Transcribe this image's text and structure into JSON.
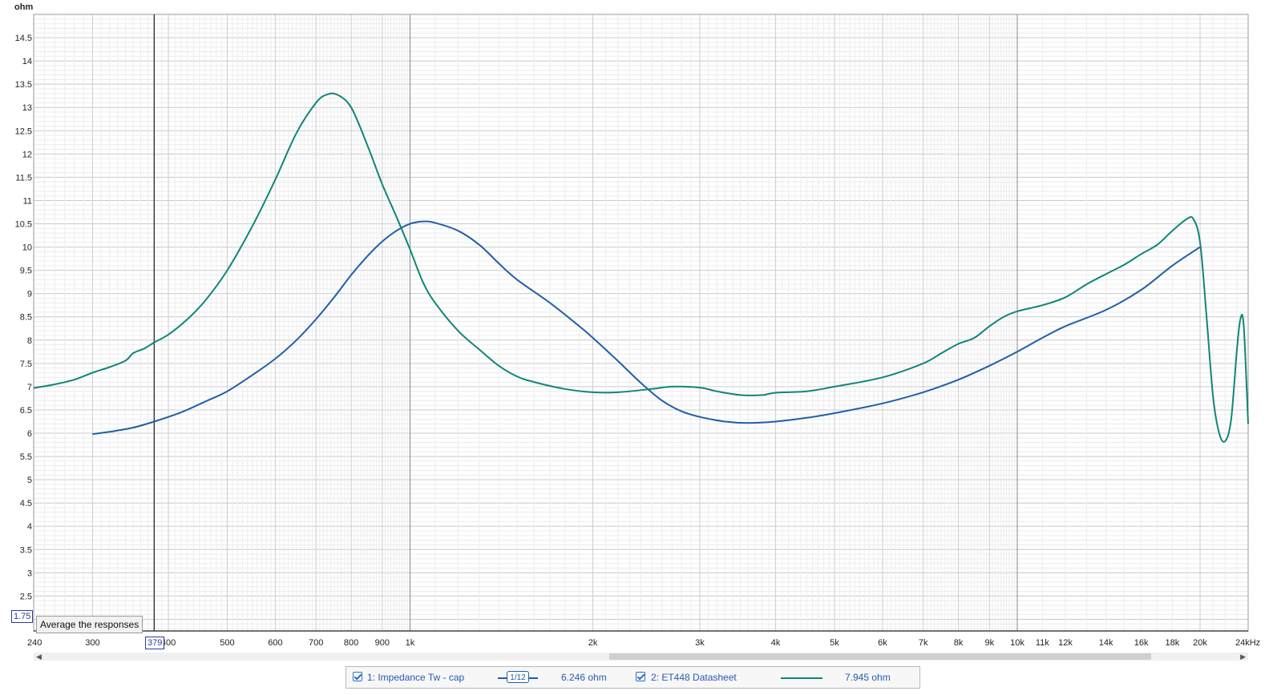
{
  "chart_data": {
    "type": "line",
    "ylabel": "ohm",
    "xunit": "Hz",
    "xscale": "log",
    "xlim": [
      240,
      24000
    ],
    "ylim": [
      1.75,
      15
    ],
    "grid": true,
    "y_ticks": [
      2,
      2.5,
      3,
      3.5,
      4,
      4.5,
      5,
      5.5,
      6,
      6.5,
      7,
      7.5,
      8,
      8.5,
      9,
      9.5,
      10,
      10.5,
      11,
      11.5,
      12,
      12.5,
      13,
      13.5,
      14,
      14.5
    ],
    "y_tick_labels": [
      "2",
      "2.5",
      "3",
      "3.5",
      "4",
      "4.5",
      "5",
      "5.5",
      "6",
      "6.5",
      "7",
      "7.5",
      "8",
      "8.5",
      "9",
      "9.5",
      "10",
      "10.5",
      "11",
      "11.5",
      "12",
      "12.5",
      "13",
      "13.5",
      "14",
      "14.5"
    ],
    "x_ticks": [
      {
        "value": 240,
        "label": "240"
      },
      {
        "value": 300,
        "label": "300"
      },
      {
        "value": 400,
        "label": "400"
      },
      {
        "value": 500,
        "label": "500"
      },
      {
        "value": 600,
        "label": "600"
      },
      {
        "value": 700,
        "label": "700"
      },
      {
        "value": 800,
        "label": "800"
      },
      {
        "value": 900,
        "label": "900"
      },
      {
        "value": 1000,
        "label": "1k"
      },
      {
        "value": 2000,
        "label": "2k"
      },
      {
        "value": 3000,
        "label": "3k"
      },
      {
        "value": 4000,
        "label": "4k"
      },
      {
        "value": 5000,
        "label": "5k"
      },
      {
        "value": 6000,
        "label": "6k"
      },
      {
        "value": 7000,
        "label": "7k"
      },
      {
        "value": 8000,
        "label": "8k"
      },
      {
        "value": 9000,
        "label": "9k"
      },
      {
        "value": 10000,
        "label": "10k"
      },
      {
        "value": 11000,
        "label": "11k"
      },
      {
        "value": 12000,
        "label": "12k"
      },
      {
        "value": 14000,
        "label": "14k"
      },
      {
        "value": 16000,
        "label": "16k"
      },
      {
        "value": 18000,
        "label": "18k"
      },
      {
        "value": 20000,
        "label": "20k"
      },
      {
        "value": 24000,
        "label": "24kHz"
      }
    ],
    "y_axis_lower_value": "1.75",
    "cursor": {
      "x": 379,
      "x_label": "379",
      "y": 1.75
    },
    "series": [
      {
        "name": "1: Impedance Tw - cap",
        "color": "#1f5fa8",
        "points": [
          [
            300,
            5.98
          ],
          [
            320,
            6.03
          ],
          [
            350,
            6.12
          ],
          [
            379,
            6.25
          ],
          [
            420,
            6.45
          ],
          [
            460,
            6.68
          ],
          [
            500,
            6.9
          ],
          [
            550,
            7.25
          ],
          [
            600,
            7.6
          ],
          [
            650,
            8.0
          ],
          [
            700,
            8.45
          ],
          [
            750,
            8.92
          ],
          [
            800,
            9.4
          ],
          [
            850,
            9.8
          ],
          [
            900,
            10.12
          ],
          [
            950,
            10.35
          ],
          [
            1000,
            10.5
          ],
          [
            1050,
            10.55
          ],
          [
            1100,
            10.52
          ],
          [
            1200,
            10.35
          ],
          [
            1300,
            10.05
          ],
          [
            1400,
            9.65
          ],
          [
            1500,
            9.3
          ],
          [
            1700,
            8.8
          ],
          [
            1900,
            8.3
          ],
          [
            2000,
            8.05
          ],
          [
            2200,
            7.55
          ],
          [
            2400,
            7.08
          ],
          [
            2600,
            6.7
          ],
          [
            2800,
            6.47
          ],
          [
            3000,
            6.35
          ],
          [
            3300,
            6.25
          ],
          [
            3600,
            6.22
          ],
          [
            4000,
            6.25
          ],
          [
            4500,
            6.33
          ],
          [
            5000,
            6.43
          ],
          [
            6000,
            6.64
          ],
          [
            7000,
            6.88
          ],
          [
            8000,
            7.15
          ],
          [
            9000,
            7.45
          ],
          [
            10000,
            7.75
          ],
          [
            11000,
            8.05
          ],
          [
            12000,
            8.3
          ],
          [
            14000,
            8.65
          ],
          [
            16000,
            9.08
          ],
          [
            18000,
            9.6
          ],
          [
            20000,
            10.0
          ]
        ]
      },
      {
        "name": "2: ET448 Datasheet",
        "color": "#11857a",
        "points": [
          [
            240,
            6.97
          ],
          [
            260,
            7.05
          ],
          [
            280,
            7.15
          ],
          [
            300,
            7.3
          ],
          [
            320,
            7.42
          ],
          [
            340,
            7.56
          ],
          [
            350,
            7.72
          ],
          [
            365,
            7.82
          ],
          [
            379,
            7.95
          ],
          [
            400,
            8.12
          ],
          [
            430,
            8.45
          ],
          [
            460,
            8.85
          ],
          [
            500,
            9.5
          ],
          [
            550,
            10.45
          ],
          [
            600,
            11.45
          ],
          [
            650,
            12.45
          ],
          [
            700,
            13.1
          ],
          [
            730,
            13.28
          ],
          [
            760,
            13.27
          ],
          [
            800,
            13.0
          ],
          [
            850,
            12.2
          ],
          [
            900,
            11.35
          ],
          [
            950,
            10.65
          ],
          [
            1000,
            9.95
          ],
          [
            1050,
            9.25
          ],
          [
            1100,
            8.8
          ],
          [
            1200,
            8.2
          ],
          [
            1300,
            7.8
          ],
          [
            1400,
            7.45
          ],
          [
            1500,
            7.22
          ],
          [
            1600,
            7.1
          ],
          [
            1800,
            6.95
          ],
          [
            2000,
            6.88
          ],
          [
            2200,
            6.88
          ],
          [
            2500,
            6.95
          ],
          [
            2700,
            7.0
          ],
          [
            3000,
            6.98
          ],
          [
            3200,
            6.9
          ],
          [
            3500,
            6.82
          ],
          [
            3800,
            6.82
          ],
          [
            4000,
            6.87
          ],
          [
            4500,
            6.9
          ],
          [
            5000,
            7.0
          ],
          [
            6000,
            7.2
          ],
          [
            7000,
            7.5
          ],
          [
            7500,
            7.72
          ],
          [
            8000,
            7.92
          ],
          [
            8500,
            8.05
          ],
          [
            9000,
            8.3
          ],
          [
            9500,
            8.5
          ],
          [
            10000,
            8.62
          ],
          [
            11000,
            8.75
          ],
          [
            12000,
            8.92
          ],
          [
            13000,
            9.2
          ],
          [
            14000,
            9.42
          ],
          [
            15000,
            9.62
          ],
          [
            16000,
            9.85
          ],
          [
            17000,
            10.05
          ],
          [
            18000,
            10.35
          ],
          [
            19000,
            10.6
          ],
          [
            19500,
            10.6
          ],
          [
            20000,
            10.1
          ],
          [
            20500,
            8.5
          ],
          [
            21000,
            6.8
          ],
          [
            21500,
            6.0
          ],
          [
            22000,
            5.83
          ],
          [
            22500,
            6.3
          ],
          [
            23000,
            7.8
          ],
          [
            23300,
            8.45
          ],
          [
            23600,
            8.3
          ],
          [
            24000,
            6.2
          ]
        ]
      }
    ]
  },
  "legend": {
    "series1_label": "1: Impedance Tw - cap",
    "series1_smoothing": "1/12",
    "series1_value": "6.246 ohm",
    "series2_label": "2: ET448 Datasheet",
    "series2_value": "7.945 ohm"
  },
  "tooltip": "Average the responses"
}
